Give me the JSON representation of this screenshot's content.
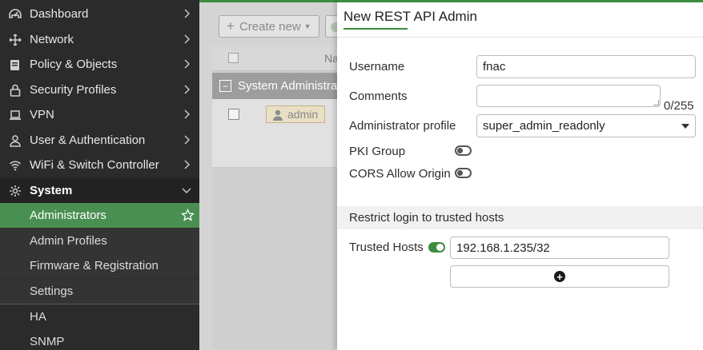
{
  "sidebar": {
    "items": [
      {
        "label": "Dashboard",
        "icon": "dashboard-icon"
      },
      {
        "label": "Network",
        "icon": "network-icon"
      },
      {
        "label": "Policy & Objects",
        "icon": "policy-icon"
      },
      {
        "label": "Security Profiles",
        "icon": "lock-icon"
      },
      {
        "label": "VPN",
        "icon": "laptop-icon"
      },
      {
        "label": "User & Authentication",
        "icon": "user-icon"
      },
      {
        "label": "WiFi & Switch Controller",
        "icon": "wifi-icon"
      },
      {
        "label": "System",
        "icon": "gear-icon"
      }
    ],
    "system_sub": [
      {
        "label": "Administrators"
      },
      {
        "label": "Admin Profiles"
      },
      {
        "label": "Firmware & Registration"
      },
      {
        "label": "Settings"
      }
    ],
    "more": [
      {
        "label": "HA"
      },
      {
        "label": "SNMP"
      }
    ]
  },
  "list": {
    "create_label": "Create new",
    "col_name": "Na",
    "group_label": "System Administrators",
    "user_label": "admin"
  },
  "panel": {
    "title": "New REST API Admin",
    "username_label": "Username",
    "username_value": "fnac",
    "comments_label": "Comments",
    "comments_counter": "0/255",
    "profile_label": "Administrator profile",
    "profile_value": "super_admin_readonly",
    "pki_label": "PKI Group",
    "cors_label": "CORS Allow Origin",
    "restrict_label": "Restrict login to trusted hosts",
    "trusted_label": "Trusted Hosts",
    "trusted_value": "192.168.1.235/32",
    "pki_on": false,
    "cors_on": false,
    "trusted_on": true
  },
  "colors": {
    "accent": "#3c8d3f",
    "sidebar_bg": "#2b2b2b"
  }
}
